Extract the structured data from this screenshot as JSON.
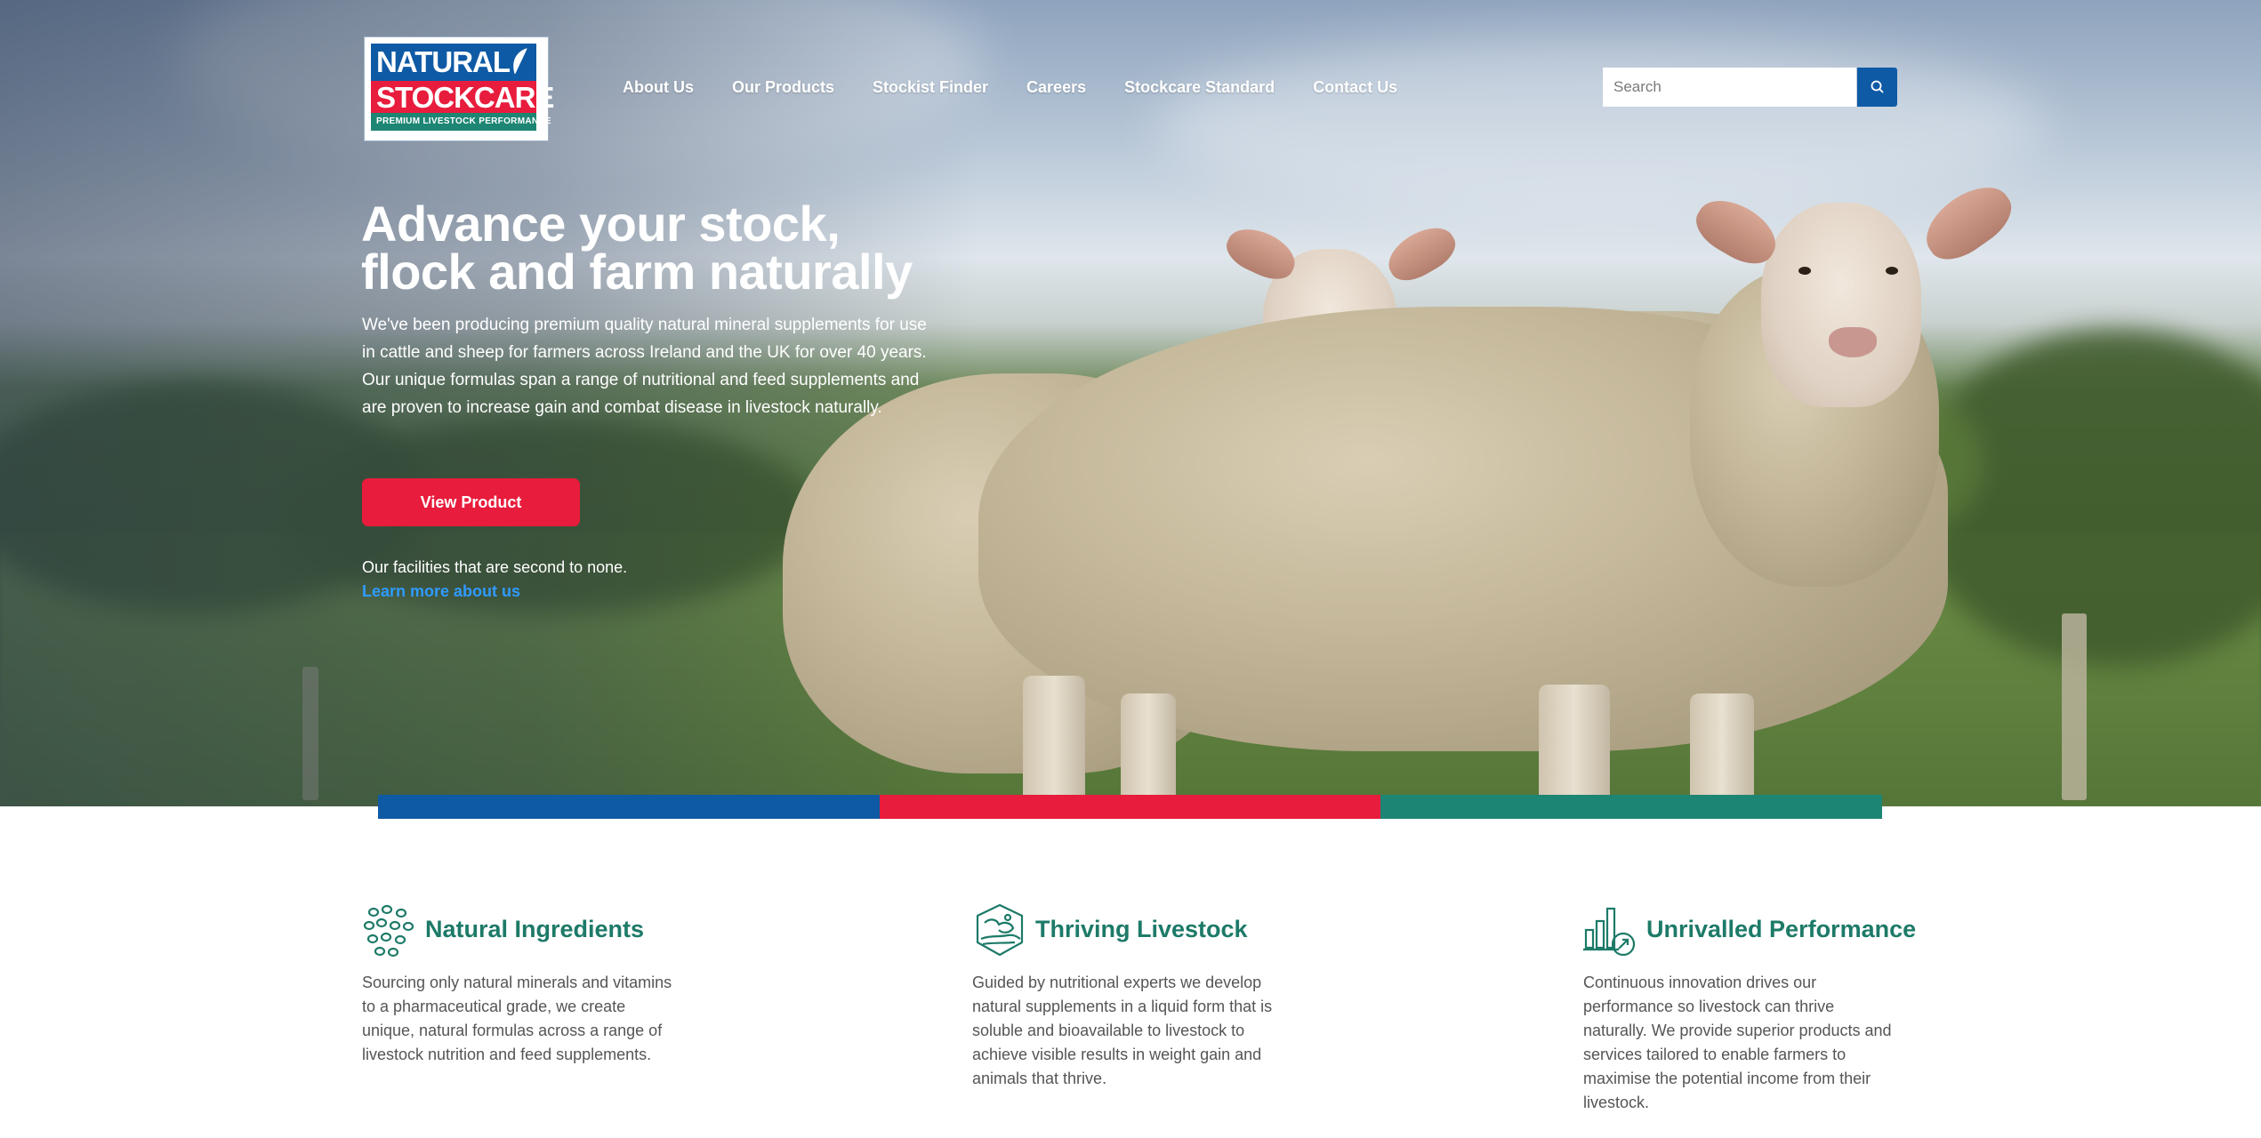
{
  "brand": {
    "line1": "NATURAL",
    "line2": "STOCKCARE",
    "tagline": "PREMIUM LIVESTOCK PERFORMANCE",
    "colors": {
      "blue": "#0f5aa5",
      "red": "#e81c3c",
      "green": "#1d8573"
    }
  },
  "nav": {
    "items": [
      {
        "label": "About Us"
      },
      {
        "label": "Our Products"
      },
      {
        "label": "Stockist Finder"
      },
      {
        "label": "Careers"
      },
      {
        "label": "Stockcare Standard"
      },
      {
        "label": "Contact Us"
      }
    ]
  },
  "search": {
    "placeholder": "Search",
    "value": "",
    "icon": "search-icon"
  },
  "hero": {
    "title_line1": "Advance your stock,",
    "title_line2": "flock and farm naturally",
    "lead": "We've been producing premium quality natural mineral supplements for use in cattle and sheep for farmers across Ireland and the UK for over 40 years. Our unique formulas span a range of nutritional and feed supplements and are proven to increase gain and combat disease in livestock naturally.",
    "button_label": "View Product",
    "facilities_text": "Our facilities that are second to none.",
    "learn_more_label": "Learn more about us"
  },
  "features": [
    {
      "icon": "ingredients-icon",
      "title": "Natural Ingredients",
      "text": "Sourcing only natural minerals and vitamins to a pharmaceutical grade, we create unique, natural formulas across a range of livestock nutrition and feed supplements."
    },
    {
      "icon": "livestock-icon",
      "title": "Thriving Livestock",
      "text": "Guided by nutritional experts we develop natural supplements in a liquid form that is soluble and bioavailable to livestock to achieve visible results in weight gain and animals that thrive."
    },
    {
      "icon": "performance-chart-icon",
      "title": "Unrivalled Performance",
      "text": "Continuous innovation drives our performance so livestock can thrive naturally. We provide superior products and services tailored to enable farmers to maximise the potential income from their livestock."
    }
  ]
}
